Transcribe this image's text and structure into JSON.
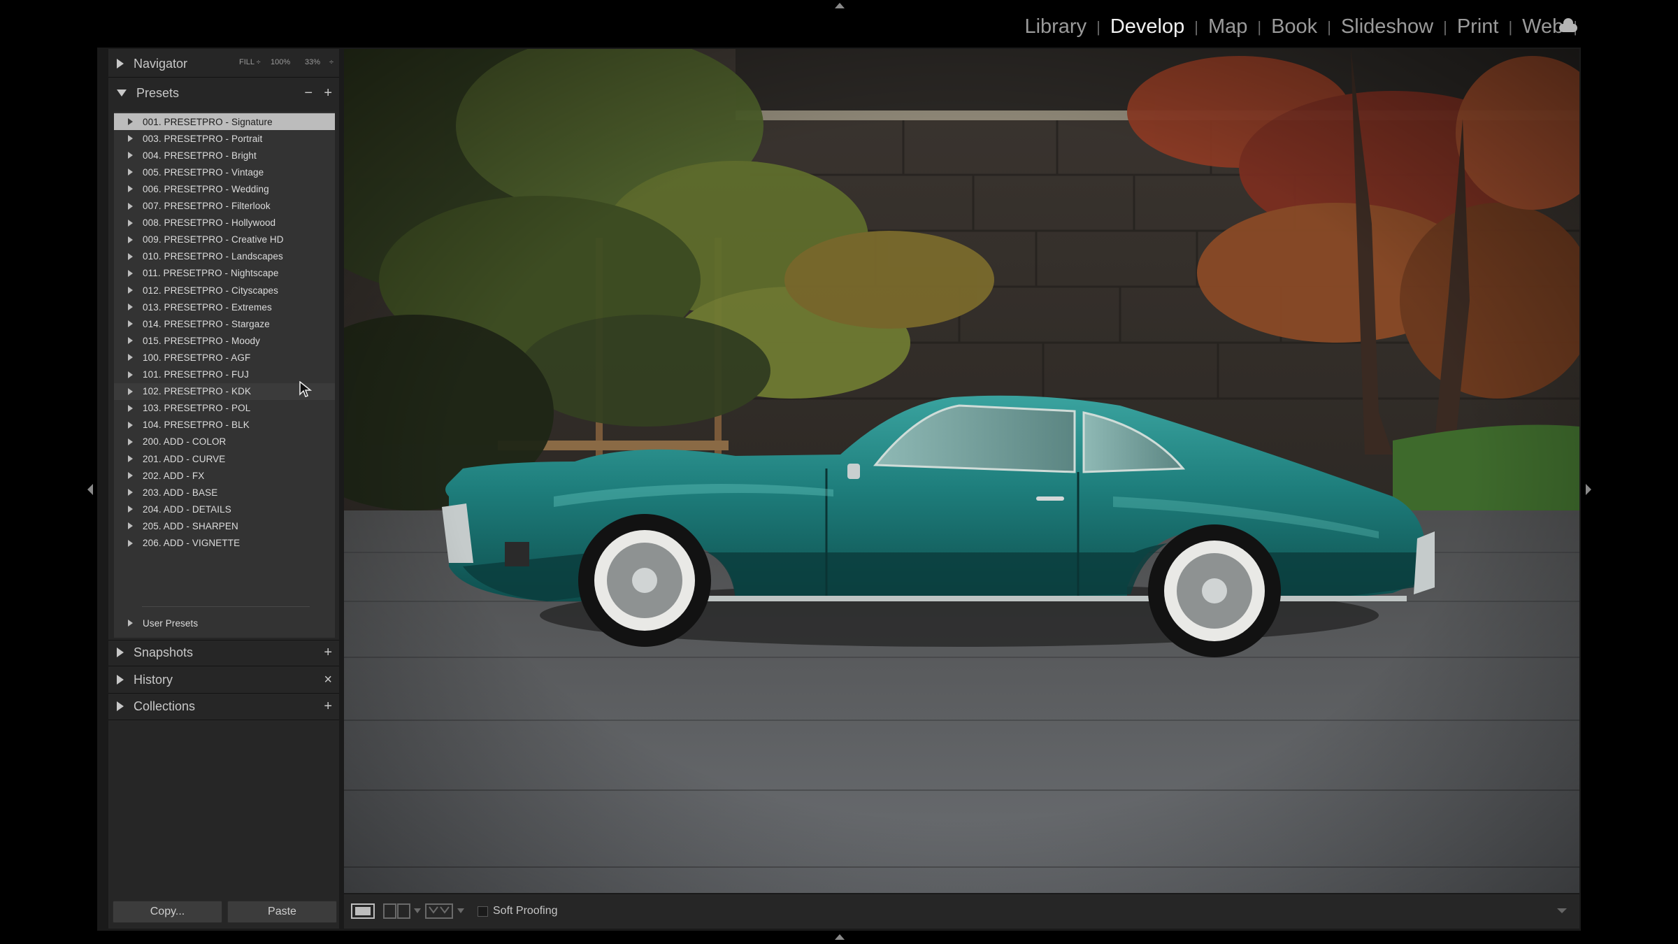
{
  "modules": {
    "items": [
      {
        "label": "Library",
        "active": false
      },
      {
        "label": "Develop",
        "active": true
      },
      {
        "label": "Map",
        "active": false
      },
      {
        "label": "Book",
        "active": false
      },
      {
        "label": "Slideshow",
        "active": false
      },
      {
        "label": "Print",
        "active": false
      },
      {
        "label": "Web",
        "active": false
      }
    ],
    "separator": "|"
  },
  "navigator": {
    "title": "Navigator",
    "zoom_fill": "FILL ÷",
    "zoom_100": "100%",
    "zoom_33": "33%",
    "zoom_more": "÷"
  },
  "presets": {
    "title": "Presets",
    "minus": "−",
    "plus": "+",
    "items": [
      "001. PRESETPRO - Signature",
      "003. PRESETPRO - Portrait",
      "004. PRESETPRO - Bright",
      "005. PRESETPRO - Vintage",
      "006. PRESETPRO - Wedding",
      "007. PRESETPRO - Filterlook",
      "008. PRESETPRO - Hollywood",
      "009. PRESETPRO - Creative HD",
      "010. PRESETPRO - Landscapes",
      "011. PRESETPRO - Nightscape",
      "012. PRESETPRO - Cityscapes",
      "013. PRESETPRO - Extremes",
      "014. PRESETPRO - Stargaze",
      "015. PRESETPRO - Moody",
      "100. PRESETPRO - AGF",
      "101. PRESETPRO - FUJ",
      "102. PRESETPRO - KDK",
      "103. PRESETPRO - POL",
      "104. PRESETPRO - BLK",
      "200. ADD - COLOR",
      "201. ADD - CURVE",
      "202. ADD - FX",
      "203. ADD - BASE",
      "204. ADD - DETAILS",
      "205. ADD - SHARPEN",
      "206. ADD - VIGNETTE"
    ],
    "user_presets": "User Presets",
    "selected_index": 0,
    "hover_index": 16
  },
  "snapshots": {
    "title": "Snapshots",
    "action": "+"
  },
  "history": {
    "title": "History",
    "action": "×"
  },
  "collections": {
    "title": "Collections",
    "action": "+"
  },
  "buttons": {
    "copy": "Copy...",
    "paste": "Paste"
  },
  "toolbar": {
    "soft_proofing": "Soft Proofing"
  },
  "icons": {
    "cloud": "cloud-icon",
    "panel_arrow": "triangle-right-icon",
    "loupe": "loupe-view-icon",
    "compare": "before-after-icon",
    "cursor": "mouse-pointer-icon"
  },
  "colors": {
    "background": "#000000",
    "panel": "#262626",
    "preset_list": "#333333",
    "selected": "#bcbcbc",
    "active_module": "#f2f2f2"
  }
}
